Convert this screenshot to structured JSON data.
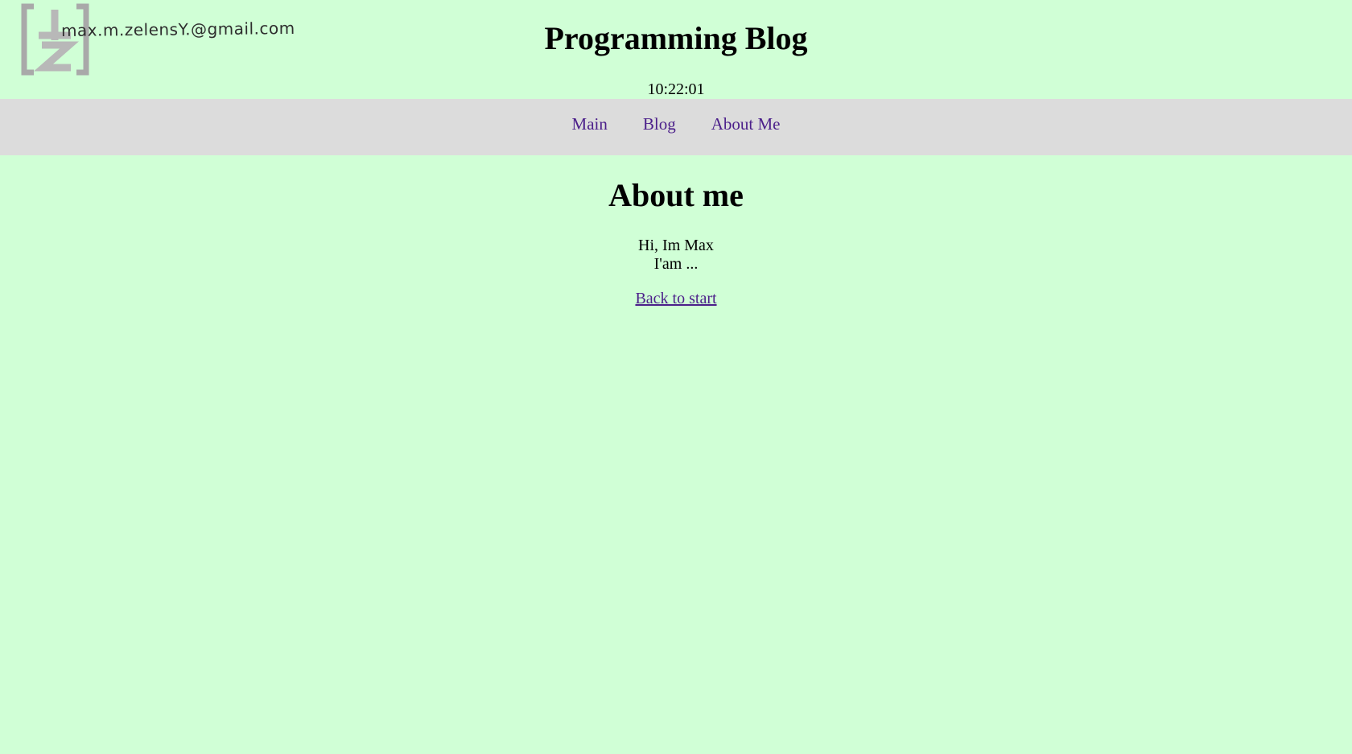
{
  "header": {
    "logo_email": "max.m.zelensY.@gmail.com",
    "title": "Programming Blog",
    "clock": "10:22:01"
  },
  "nav": {
    "items": [
      {
        "label": "Main"
      },
      {
        "label": "Blog"
      },
      {
        "label": "About Me"
      }
    ]
  },
  "main": {
    "heading": "About me",
    "intro_line1": "Hi, Im Max",
    "intro_line2": "I'am ...",
    "back_link": "Back to start"
  },
  "colors": {
    "background": "#d0ffd6",
    "nav_background": "#dcdcdc",
    "link": "#4b1f8a"
  }
}
